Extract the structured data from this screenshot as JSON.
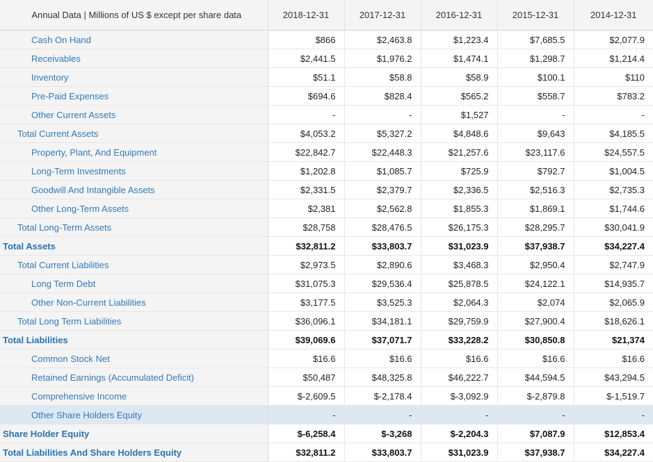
{
  "table": {
    "header": {
      "label_column": "Annual Data | Millions of US $ except per share data",
      "periods": [
        "2018-12-31",
        "2017-12-31",
        "2016-12-31",
        "2015-12-31",
        "2014-12-31"
      ]
    },
    "colors": {
      "link_blue": "#337ab7",
      "total_blue": "#2b72ab",
      "label_bg": "#f4f4f4",
      "value_bg": "#ffffff",
      "highlight_bg": "#dde8f2",
      "border": "#e6e6e6",
      "header_text": "#333333"
    },
    "rows": [
      {
        "label": "Cash On Hand",
        "indent": 2,
        "total": false,
        "highlight": false,
        "values": [
          "$866",
          "$2,463.8",
          "$1,223.4",
          "$7,685.5",
          "$2,077.9"
        ]
      },
      {
        "label": "Receivables",
        "indent": 2,
        "total": false,
        "highlight": false,
        "values": [
          "$2,441.5",
          "$1,976.2",
          "$1,474.1",
          "$1,298.7",
          "$1,214.4"
        ]
      },
      {
        "label": "Inventory",
        "indent": 2,
        "total": false,
        "highlight": false,
        "values": [
          "$51.1",
          "$58.8",
          "$58.9",
          "$100.1",
          "$110"
        ]
      },
      {
        "label": "Pre-Paid Expenses",
        "indent": 2,
        "total": false,
        "highlight": false,
        "values": [
          "$694.6",
          "$828.4",
          "$565.2",
          "$558.7",
          "$783.2"
        ]
      },
      {
        "label": "Other Current Assets",
        "indent": 2,
        "total": false,
        "highlight": false,
        "values": [
          "-",
          "-",
          "$1,527",
          "-",
          "-"
        ]
      },
      {
        "label": "Total Current Assets",
        "indent": 1,
        "total": false,
        "highlight": false,
        "values": [
          "$4,053.2",
          "$5,327.2",
          "$4,848.6",
          "$9,643",
          "$4,185.5"
        ]
      },
      {
        "label": "Property, Plant, And Equipment",
        "indent": 2,
        "total": false,
        "highlight": false,
        "values": [
          "$22,842.7",
          "$22,448.3",
          "$21,257.6",
          "$23,117.6",
          "$24,557.5"
        ]
      },
      {
        "label": "Long-Term Investments",
        "indent": 2,
        "total": false,
        "highlight": false,
        "values": [
          "$1,202.8",
          "$1,085.7",
          "$725.9",
          "$792.7",
          "$1,004.5"
        ]
      },
      {
        "label": "Goodwill And Intangible Assets",
        "indent": 2,
        "total": false,
        "highlight": false,
        "values": [
          "$2,331.5",
          "$2,379.7",
          "$2,336.5",
          "$2,516.3",
          "$2,735.3"
        ]
      },
      {
        "label": "Other Long-Term Assets",
        "indent": 2,
        "total": false,
        "highlight": false,
        "values": [
          "$2,381",
          "$2,562.8",
          "$1,855.3",
          "$1,869.1",
          "$1,744.6"
        ]
      },
      {
        "label": "Total Long-Term Assets",
        "indent": 1,
        "total": false,
        "highlight": false,
        "values": [
          "$28,758",
          "$28,476.5",
          "$26,175.3",
          "$28,295.7",
          "$30,041.9"
        ]
      },
      {
        "label": "Total Assets",
        "indent": 0,
        "total": true,
        "highlight": false,
        "values": [
          "$32,811.2",
          "$33,803.7",
          "$31,023.9",
          "$37,938.7",
          "$34,227.4"
        ]
      },
      {
        "label": "Total Current Liabilities",
        "indent": 1,
        "total": false,
        "highlight": false,
        "values": [
          "$2,973.5",
          "$2,890.6",
          "$3,468.3",
          "$2,950.4",
          "$2,747.9"
        ]
      },
      {
        "label": "Long Term Debt",
        "indent": 2,
        "total": false,
        "highlight": false,
        "values": [
          "$31,075.3",
          "$29,536.4",
          "$25,878.5",
          "$24,122.1",
          "$14,935.7"
        ]
      },
      {
        "label": "Other Non-Current Liabilities",
        "indent": 2,
        "total": false,
        "highlight": false,
        "values": [
          "$3,177.5",
          "$3,525.3",
          "$2,064.3",
          "$2,074",
          "$2,065.9"
        ]
      },
      {
        "label": "Total Long Term Liabilities",
        "indent": 1,
        "total": false,
        "highlight": false,
        "values": [
          "$36,096.1",
          "$34,181.1",
          "$29,759.9",
          "$27,900.4",
          "$18,626.1"
        ]
      },
      {
        "label": "Total Liabilities",
        "indent": 0,
        "total": true,
        "highlight": false,
        "values": [
          "$39,069.6",
          "$37,071.7",
          "$33,228.2",
          "$30,850.8",
          "$21,374"
        ]
      },
      {
        "label": "Common Stock Net",
        "indent": 2,
        "total": false,
        "highlight": false,
        "values": [
          "$16.6",
          "$16.6",
          "$16.6",
          "$16.6",
          "$16.6"
        ]
      },
      {
        "label": "Retained Earnings (Accumulated Deficit)",
        "indent": 2,
        "total": false,
        "highlight": false,
        "values": [
          "$50,487",
          "$48,325.8",
          "$46,222.7",
          "$44,594.5",
          "$43,294.5"
        ]
      },
      {
        "label": "Comprehensive Income",
        "indent": 2,
        "total": false,
        "highlight": false,
        "values": [
          "$-2,609.5",
          "$-2,178.4",
          "$-3,092.9",
          "$-2,879.8",
          "$-1,519.7"
        ]
      },
      {
        "label": "Other Share Holders Equity",
        "indent": 2,
        "total": false,
        "highlight": true,
        "values": [
          "-",
          "-",
          "-",
          "-",
          "-"
        ]
      },
      {
        "label": "Share Holder Equity",
        "indent": 0,
        "total": true,
        "highlight": false,
        "values": [
          "$-6,258.4",
          "$-3,268",
          "$-2,204.3",
          "$7,087.9",
          "$12,853.4"
        ]
      },
      {
        "label": "Total Liabilities And Share Holders Equity",
        "indent": 0,
        "total": true,
        "highlight": false,
        "values": [
          "$32,811.2",
          "$33,803.7",
          "$31,023.9",
          "$37,938.7",
          "$34,227.4"
        ]
      }
    ]
  }
}
